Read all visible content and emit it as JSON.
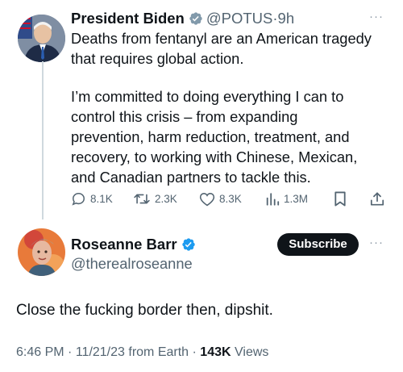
{
  "tweet": {
    "author_name": "President Biden",
    "handle": "@POTUS",
    "separator": "·",
    "time": "9h",
    "more": "···",
    "body_lines": [
      "Deaths from fentanyl are an American tragedy",
      "that requires global action.",
      "I’m committed to doing everything I can to",
      "control this crisis – from expanding",
      "prevention, harm reduction, treatment, and",
      "recovery, to working with Chinese, Mexican,",
      "and Canadian partners to tackle this."
    ],
    "replies": "8.1K",
    "reposts": "2.3K",
    "likes": "8.3K",
    "views": "1.3M"
  },
  "reply": {
    "author_name": "Roseanne Barr",
    "handle": "@therealroseanne",
    "subscribe_label": "Subscribe",
    "more": "···",
    "text": "Close the fucking border then, dipshit.",
    "time": "6:46 PM",
    "date": "11/21/23",
    "source": "from Earth",
    "views_count": "143K",
    "views_label": "Views"
  },
  "colors": {
    "verified_blue": "#1d9bf0",
    "muted_text": "#536471",
    "subscribe_bg": "#0f1419",
    "thread_line": "#cfd9de"
  },
  "icons": [
    "verified-badge-icon",
    "reply-icon",
    "repost-icon",
    "like-icon",
    "views-icon",
    "bookmark-icon",
    "share-icon",
    "more-icon"
  ]
}
